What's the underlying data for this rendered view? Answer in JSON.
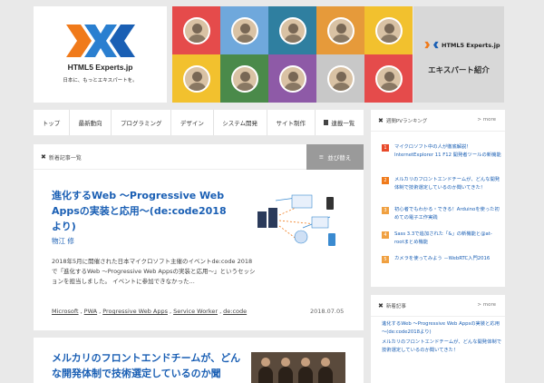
{
  "header": {
    "logo_text": "HTML5 Experts.jp",
    "logo_tagline": "日本に、もっとエキスパートを。",
    "intro_logo_text": "HTML5 Experts.jp",
    "intro_label": "エキスパート紹介",
    "expert_tiles": [
      "#e54b4b",
      "#6fa8dc",
      "#2f7fa0",
      "#e69a3a",
      "#f2c12e",
      "#f2c12e",
      "#4a8a4a",
      "#8e5aa7",
      "#c8c8c8",
      "#e54b4b"
    ]
  },
  "nav": {
    "items": [
      "トップ",
      "最新動向",
      "プログラミング",
      "デザイン",
      "システム開発",
      "サイト制作"
    ],
    "serial_label": "連載一覧"
  },
  "main": {
    "section_label": "新着記事一覧",
    "sort_label": "並び替え",
    "articles": [
      {
        "title": "進化するWeb ～Progressive Web Appsの実装と応用～(de:code2018より)",
        "author": "物江 修",
        "excerpt": "2018年5月に開催された日本マイクロソフト主催のイベントde:code 2018で「進化するWeb ～Progressive Web Appsの実装と応用～」というセッションを担当しました。 イベントに参加できなかった...",
        "tags": [
          "Microsoft",
          "PWA",
          "Progressive Web Apps",
          "Service Worker",
          "de:code"
        ],
        "date": "2018.07.05"
      },
      {
        "title": "メルカリのフロントエンドチームが、どんな開発体制で技術選定しているのか聞"
      }
    ]
  },
  "sidebar": {
    "ranking_label": "週間PVランキング",
    "more_label": "> more",
    "ranking": [
      {
        "num": "1",
        "text": "マイクロソフト中の人が徹底解説！InternetExplorer 11 F12 開発者ツールの新機能"
      },
      {
        "num": "2",
        "text": "メルカリのフロントエンドチームが、どんな開発体制で技術選定しているのか聞いてきた！"
      },
      {
        "num": "3",
        "text": "初心者でもわかる・できる！Arduinoを使った初めての電子工作実践"
      },
      {
        "num": "4",
        "text": "Sass 3.3で追加された「&」の新機能と@at-rootまとめ機能"
      },
      {
        "num": "5",
        "text": "カメラを使ってみよう －WebRTC入門2016"
      }
    ],
    "news_label": "新着記事",
    "news": [
      "進化するWeb ～Progressive Web Appsの実装と応用～(de:code2018より)",
      "メルカリのフロントエンドチームが、どんな開発体制で技術選定しているのか聞いてきた！"
    ]
  }
}
